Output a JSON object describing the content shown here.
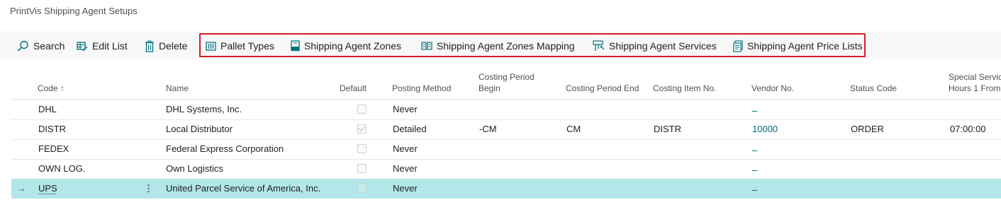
{
  "page": {
    "title": "PrintVis Shipping Agent Setups"
  },
  "actions": {
    "search": "Search",
    "edit_list": "Edit List",
    "delete": "Delete",
    "pallet_types": "Pallet Types",
    "zones": "Shipping Agent Zones",
    "zones_mapping": "Shipping Agent Zones Mapping",
    "services": "Shipping Agent Services",
    "price_lists": "Shipping Agent Price Lists"
  },
  "columns": {
    "code": "Code ↑",
    "name": "Name",
    "default": "Default",
    "posting_method": "Posting Method",
    "cpb_line1": "Costing Period",
    "cpb_line2": "Begin",
    "costing_period_end": "Costing Period End",
    "costing_item_no": "Costing Item No.",
    "vendor_no": "Vendor No.",
    "status_code": "Status Code",
    "ssh_line1": "Special Service",
    "ssh_line2": "Hours 1 From"
  },
  "rows": [
    {
      "code": "DHL",
      "name": "DHL Systems, Inc.",
      "default": false,
      "posting_method": "Never",
      "cpb": "",
      "cpe": "",
      "item": "",
      "vendor": "_",
      "status": "",
      "ssh": ""
    },
    {
      "code": "DISTR",
      "name": "Local Distributor",
      "default": true,
      "posting_method": "Detailed",
      "cpb": "-CM",
      "cpe": "CM",
      "item": "DISTR",
      "vendor": "10000",
      "status": "ORDER",
      "ssh": "07:00:00"
    },
    {
      "code": "FEDEX",
      "name": "Federal Express Corporation",
      "default": false,
      "posting_method": "Never",
      "cpb": "",
      "cpe": "",
      "item": "",
      "vendor": "_",
      "status": "",
      "ssh": ""
    },
    {
      "code": "OWN LOG.",
      "name": "Own Logistics",
      "default": false,
      "posting_method": "Never",
      "cpb": "",
      "cpe": "",
      "item": "",
      "vendor": "_",
      "status": "",
      "ssh": ""
    },
    {
      "code": "UPS",
      "name": "United Parcel Service of America, Inc.",
      "default": false,
      "posting_method": "Never",
      "cpb": "",
      "cpe": "",
      "item": "",
      "vendor": "_",
      "status": "",
      "ssh": ""
    }
  ],
  "selected_row_marker": "→",
  "row_menu": "⋮",
  "colors": {
    "accent_link": "#00707c",
    "selected_row": "#b2e6e8",
    "highlight_box": "#d21f2a"
  }
}
